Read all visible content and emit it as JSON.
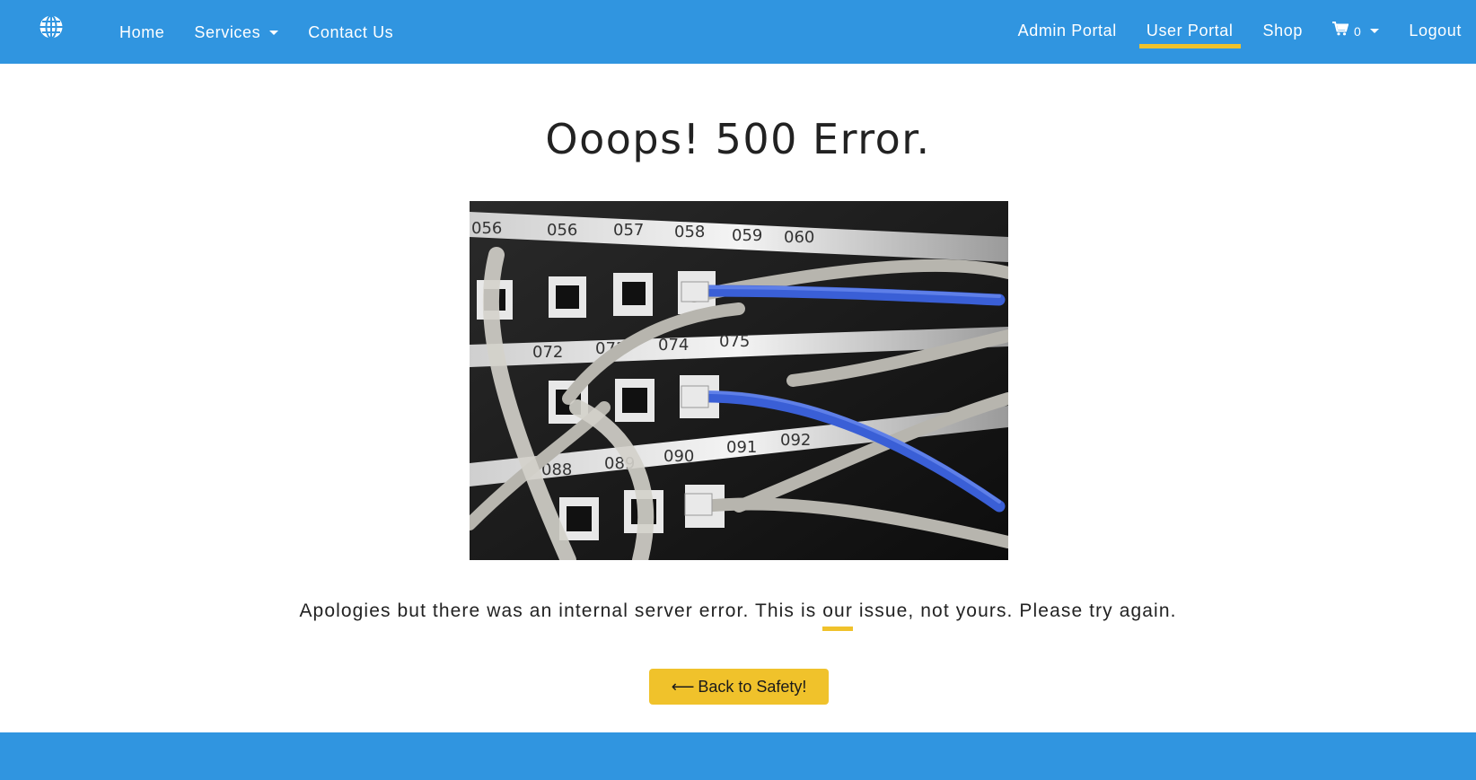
{
  "navbar": {
    "brand_icon": "globe-icon",
    "left_links": {
      "home": "Home",
      "services": "Services",
      "contact": "Contact Us"
    },
    "right_links": {
      "admin": "Admin Portal",
      "user": "User Portal",
      "shop": "Shop",
      "cart_count": "0",
      "logout": "Logout"
    },
    "active_link": "User Portal"
  },
  "main": {
    "title": "Ooops! 500 Error.",
    "image_icon": "network-patch-panel-photo",
    "message": {
      "before": "Apologies but there was an internal server error. This is ",
      "emphasis": "our",
      "after": " issue, not yours. Please try again."
    },
    "back_button": {
      "icon": "arrow-left-icon",
      "label": "Back to Safety!"
    }
  },
  "colors": {
    "primary": "#3095e0",
    "accent": "#f0c22b",
    "text": "#222222"
  }
}
